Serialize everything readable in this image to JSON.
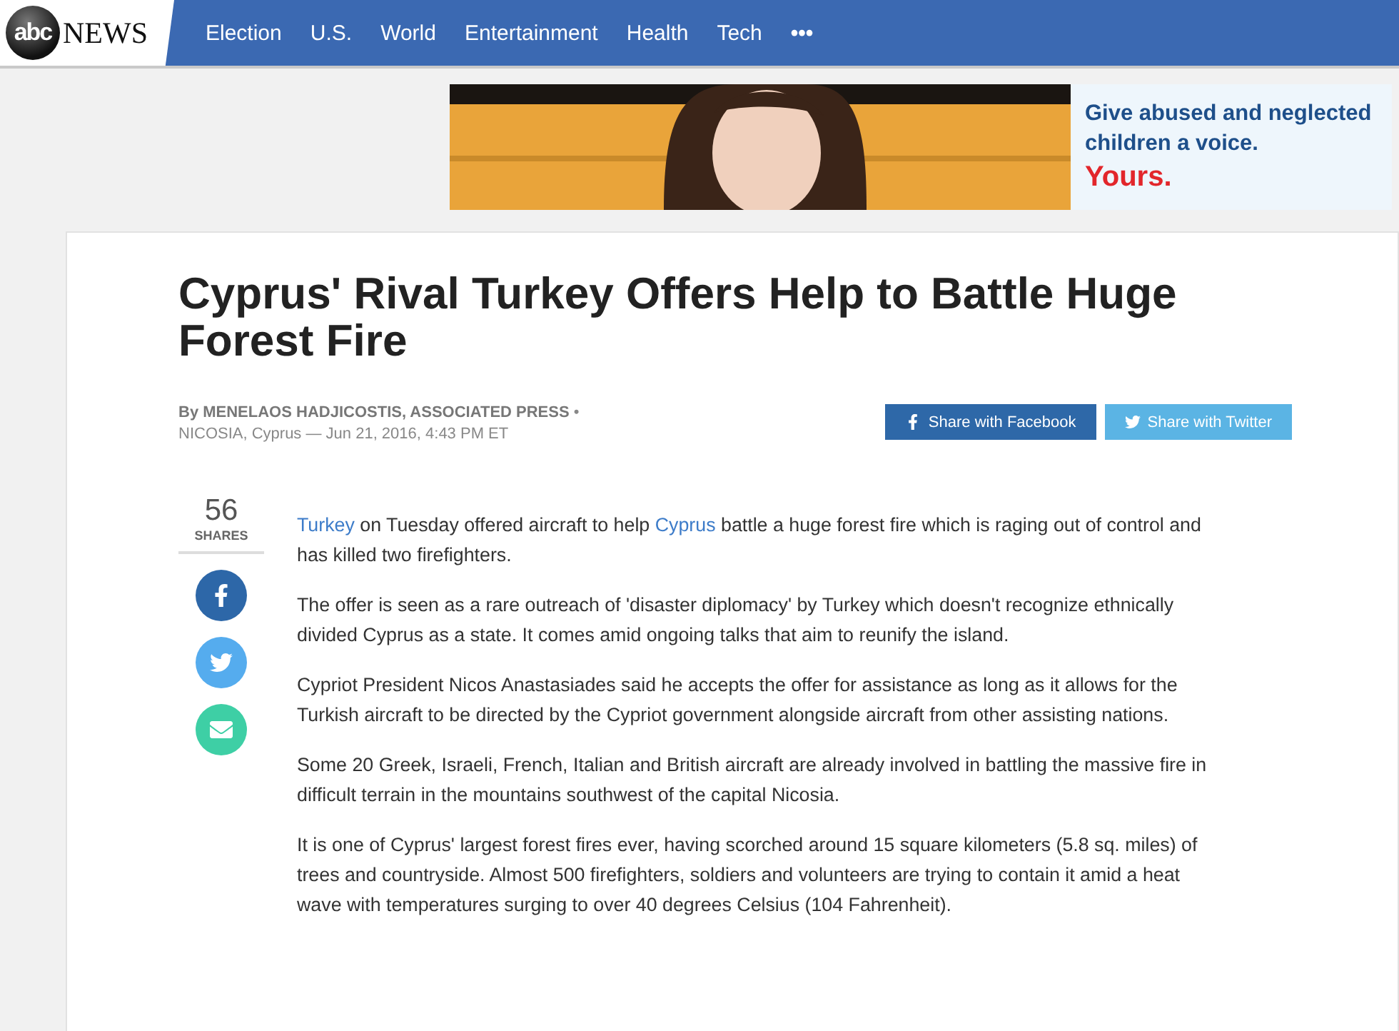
{
  "logo": {
    "mark": "abc",
    "word": "NEWS"
  },
  "nav": [
    "Election",
    "U.S.",
    "World",
    "Entertainment",
    "Health",
    "Tech",
    "•••"
  ],
  "ad": {
    "kind": "picture",
    "lines": [
      "Give abused and neglected children a voice."
    ],
    "tagline": "Yours."
  },
  "article": {
    "title": "Cyprus' Rival Turkey Offers Help to Battle Huge Forest Fire",
    "byline": "By MENELAOS HADJICOSTIS, ASSOCIATED PRESS",
    "separator": "•",
    "dateline": "NICOSIA, Cyprus — Jun 21, 2016, 4:43 PM ET",
    "share_buttons": [
      {
        "kind": "facebook",
        "label": "Share with Facebook"
      },
      {
        "kind": "twitter",
        "label": "Share with Twitter"
      }
    ],
    "shares": {
      "count": "56",
      "label": "SHARES"
    },
    "share_icons": [
      {
        "kind": "facebook"
      },
      {
        "kind": "twitter"
      },
      {
        "kind": "email"
      }
    ],
    "paragraphs": [
      [
        {
          "text": "Turkey",
          "link": true
        },
        {
          "text": " on Tuesday offered aircraft to help ",
          "link": false
        },
        {
          "text": "Cyprus",
          "link": true
        },
        {
          "text": " battle a huge forest fire which is raging out of control and has killed two firefighters.",
          "link": false
        }
      ],
      [
        {
          "text": "The offer is seen as a rare outreach of 'disaster diplomacy' by Turkey which doesn't recognize ethnically divided Cyprus as a state. It comes amid ongoing talks that aim to reunify the island.",
          "link": false
        }
      ],
      [
        {
          "text": "Cypriot President Nicos Anastasiades said he accepts the offer for assistance as long as it allows for the Turkish aircraft to be directed by the Cypriot government alongside aircraft from other assisting nations.",
          "link": false
        }
      ],
      [
        {
          "text": "Some 20 Greek, Israeli, French, Italian and British aircraft are already involved in battling the massive fire in difficult terrain in the mountains southwest of the capital Nicosia.",
          "link": false
        }
      ],
      [
        {
          "text": "It is one of Cyprus' largest forest fires ever, having scorched around 15 square kilometers (5.8 sq. miles) of trees and countryside. Almost 500 firefighters, soldiers and volunteers are trying to contain it amid a heat wave with temperatures surging to over 40 degrees Celsius (104 Fahrenheit).",
          "link": false
        }
      ]
    ]
  }
}
